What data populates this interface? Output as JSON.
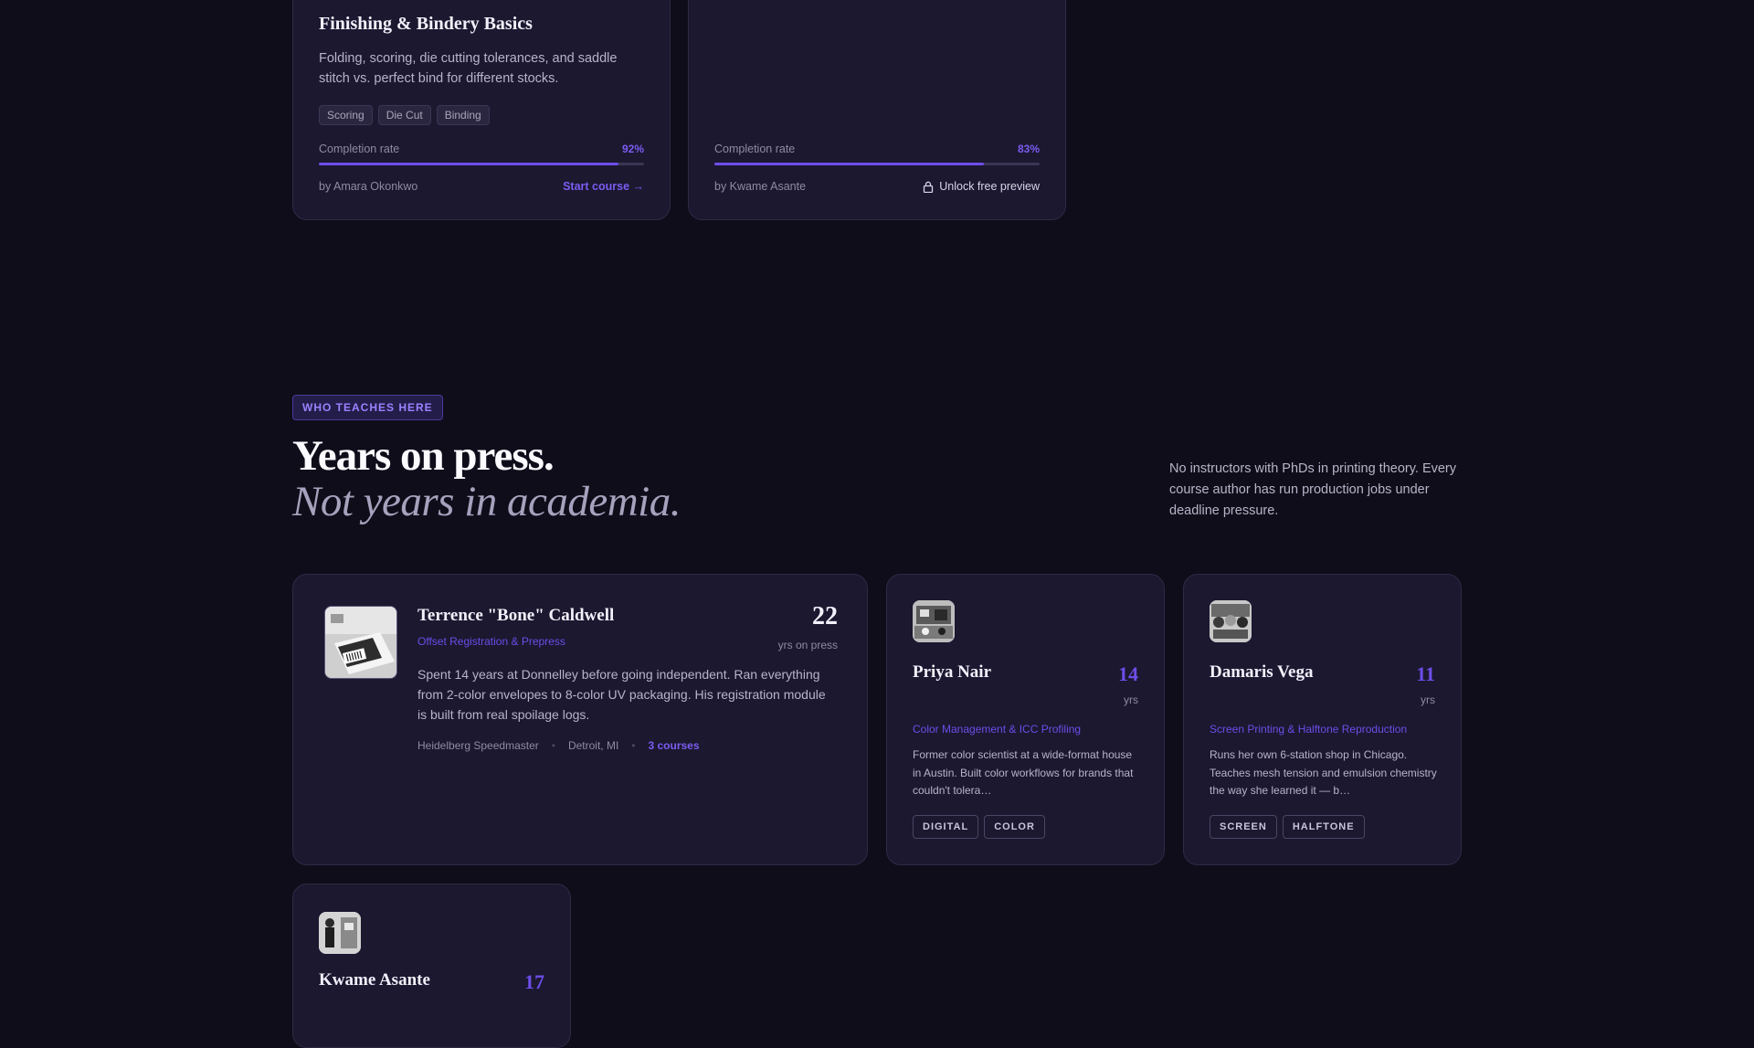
{
  "courses": [
    {
      "title": "Finishing & Bindery Basics",
      "description": "Folding, scoring, die cutting tolerances, and saddle stitch vs. perfect bind for different stocks.",
      "tags": [
        "Scoring",
        "Die Cut",
        "Binding"
      ],
      "completion_label": "Completion rate",
      "completion_value": "92%",
      "completion_fraction": 0.92,
      "author": "by Amara Okonkwo",
      "action": "Start course →"
    },
    {
      "title": "",
      "description": "",
      "tags": [],
      "completion_label": "Completion rate",
      "completion_value": "83%",
      "completion_fraction": 0.83,
      "author": "by Kwame Asante",
      "action": "Unlock free preview",
      "action_icon": "lock-icon"
    }
  ],
  "section": {
    "badge": "WHO TEACHES HERE",
    "heading_line1": "Years on press.",
    "heading_line2": "Not years in academia.",
    "side_note": "No instructors with PhDs in printing theory. Every course author has run production jobs under deadline pressure."
  },
  "featured_instructor": {
    "name": "Terrence \"Bone\" Caldwell",
    "specialty": "Offset Registration & Prepress",
    "years": "22",
    "years_label": "yrs on press",
    "bio": "Spent 14 years at Donnelley before going independent. Ran everything from 2-color envelopes to 8-color UV packaging. His registration module is built from real spoilage logs.",
    "equipment": "Heidelberg Speedmaster",
    "location": "Detroit, MI",
    "courses_link": "3 courses",
    "separator": "•"
  },
  "instructors": [
    {
      "name": "Priya Nair",
      "years": "14",
      "years_label": "yrs",
      "specialty": "Color Management & ICC Profiling",
      "bio": "Former color scientist at a wide-format house in Austin. Built color workflows for brands that couldn't tolera…",
      "chips": [
        "DIGITAL",
        "COLOR"
      ]
    },
    {
      "name": "Damaris Vega",
      "years": "11",
      "years_label": "yrs",
      "specialty": "Screen Printing & Halftone Reproduction",
      "bio": "Runs her own 6-station shop in Chicago. Teaches mesh tension and emulsion chemistry the way she learned it — b…",
      "chips": [
        "SCREEN",
        "HALFTONE"
      ]
    },
    {
      "name": "Kwame Asante",
      "years": "17",
      "years_label": "yrs"
    }
  ],
  "colors": {
    "background": "#0f0d1a",
    "card": "#1b1830",
    "accent": "#6d4de8"
  }
}
